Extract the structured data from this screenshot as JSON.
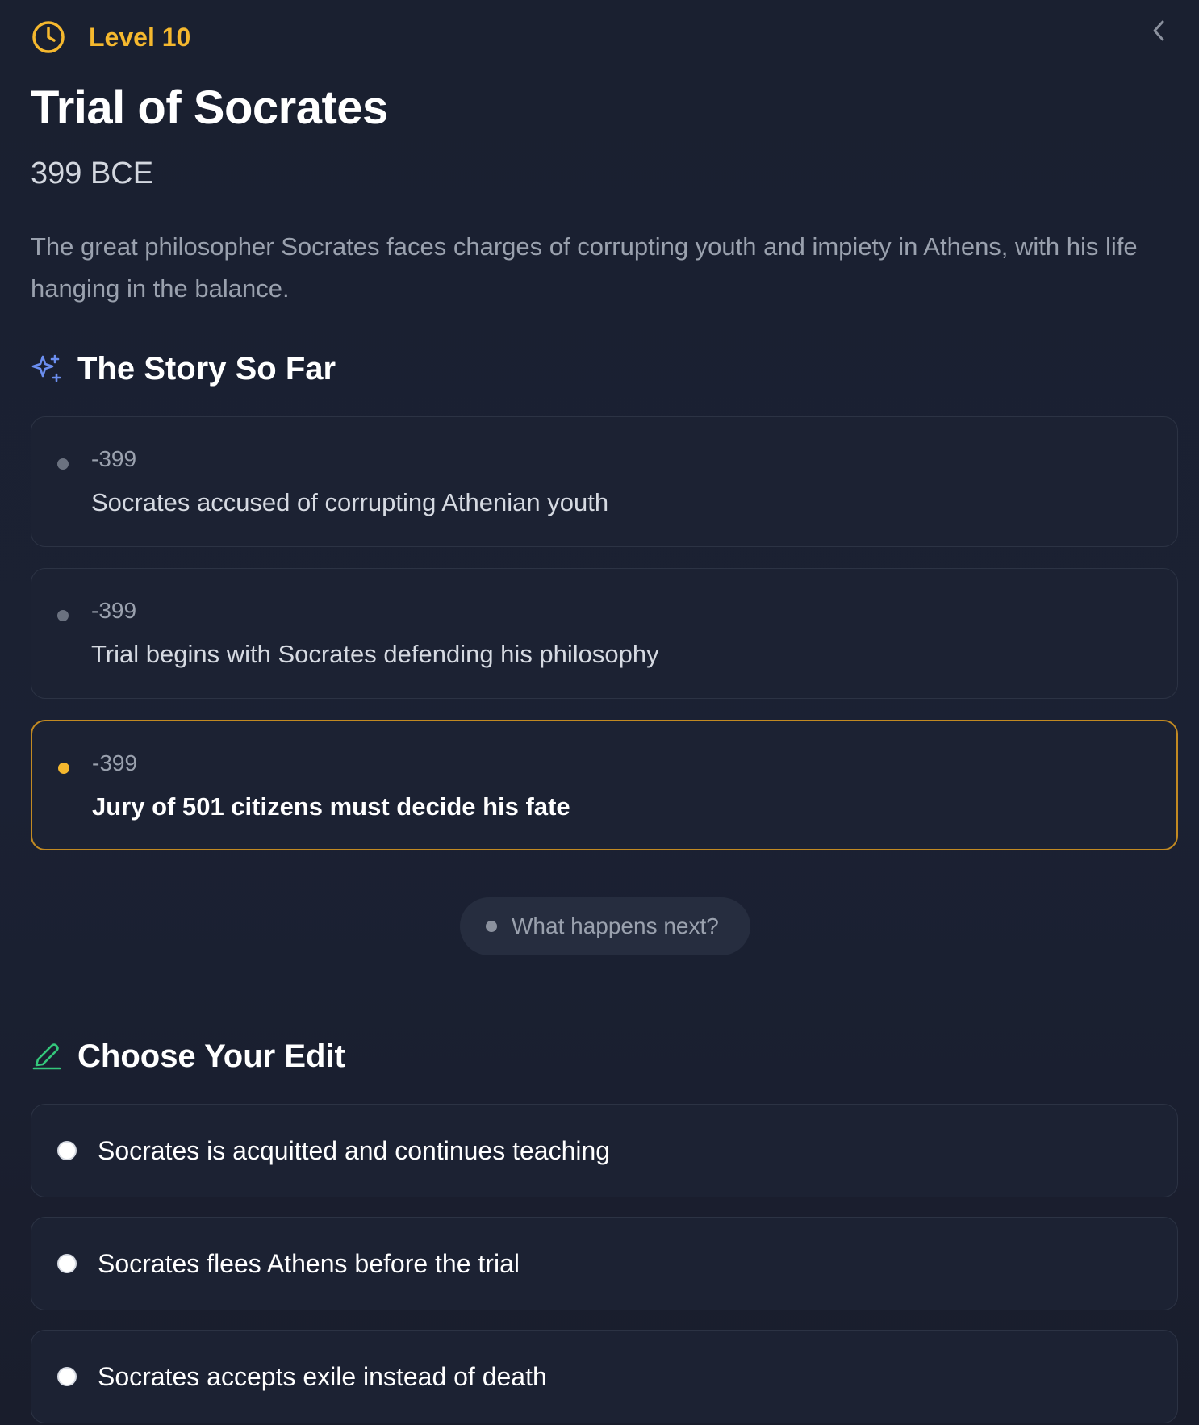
{
  "header": {
    "level_label": "Level 10",
    "title": "Trial of Socrates",
    "date": "399 BCE",
    "description": "The great philosopher Socrates faces charges of corrupting youth and impiety in Athens, with his life hanging in the balance."
  },
  "story": {
    "heading": "The Story So Far",
    "events": [
      {
        "year": "-399",
        "text": "Socrates accused of corrupting Athenian youth",
        "current": false
      },
      {
        "year": "-399",
        "text": "Trial begins with Socrates defending his philosophy",
        "current": false
      },
      {
        "year": "-399",
        "text": "Jury of 501 citizens must decide his fate",
        "current": true
      }
    ],
    "next_prompt": "What happens next?"
  },
  "edits": {
    "heading": "Choose Your Edit",
    "options": [
      {
        "text": "Socrates is acquitted and continues teaching"
      },
      {
        "text": "Socrates flees Athens before the trial"
      },
      {
        "text": "Socrates accepts exile instead of death"
      }
    ]
  },
  "colors": {
    "accent_gold": "#f5b82e",
    "sparkle_blue": "#6b8ef0",
    "pencil_green": "#34c77b",
    "background": "#1a2030"
  },
  "icons": {
    "level": "clock-icon",
    "back": "chevron-left-icon",
    "story": "sparkles-icon",
    "edit": "pencil-icon"
  }
}
